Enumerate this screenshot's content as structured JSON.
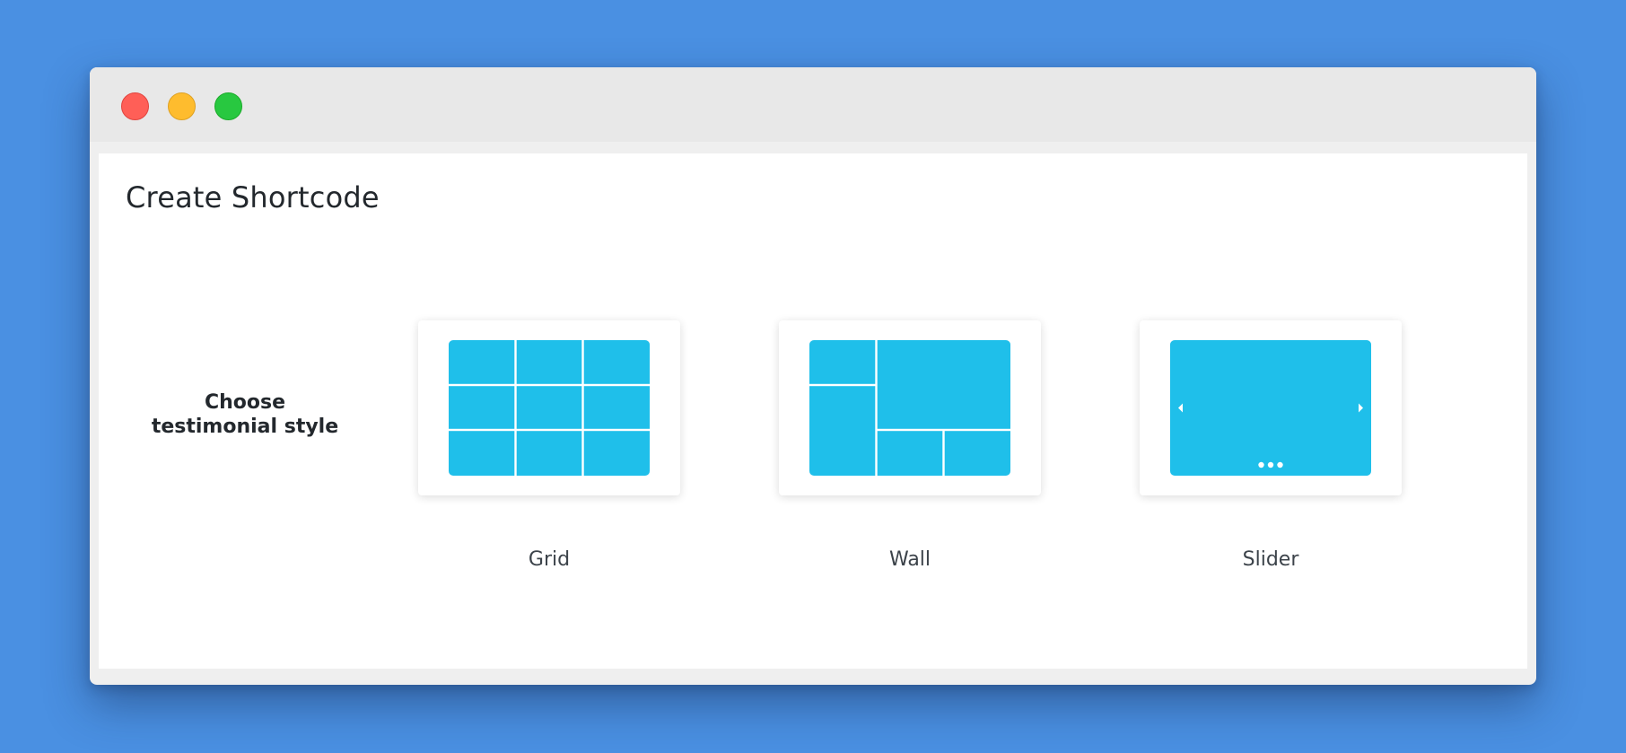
{
  "window": {
    "controls": {
      "close_icon": "close-dot-icon",
      "minimize_icon": "minimize-dot-icon",
      "maximize_icon": "maximize-dot-icon"
    }
  },
  "page": {
    "title": "Create Shortcode",
    "style_prompt": "Choose testimonial style"
  },
  "styles": [
    {
      "label": "Grid",
      "icon": "grid-layout-icon"
    },
    {
      "label": "Wall",
      "icon": "wall-layout-icon"
    },
    {
      "label": "Slider",
      "icon": "slider-layout-icon"
    }
  ],
  "colors": {
    "background": "#4a90e2",
    "preview_blue": "#1fbfea",
    "close": "#ff5f57",
    "minimize": "#febc2e",
    "maximize": "#28c840"
  }
}
